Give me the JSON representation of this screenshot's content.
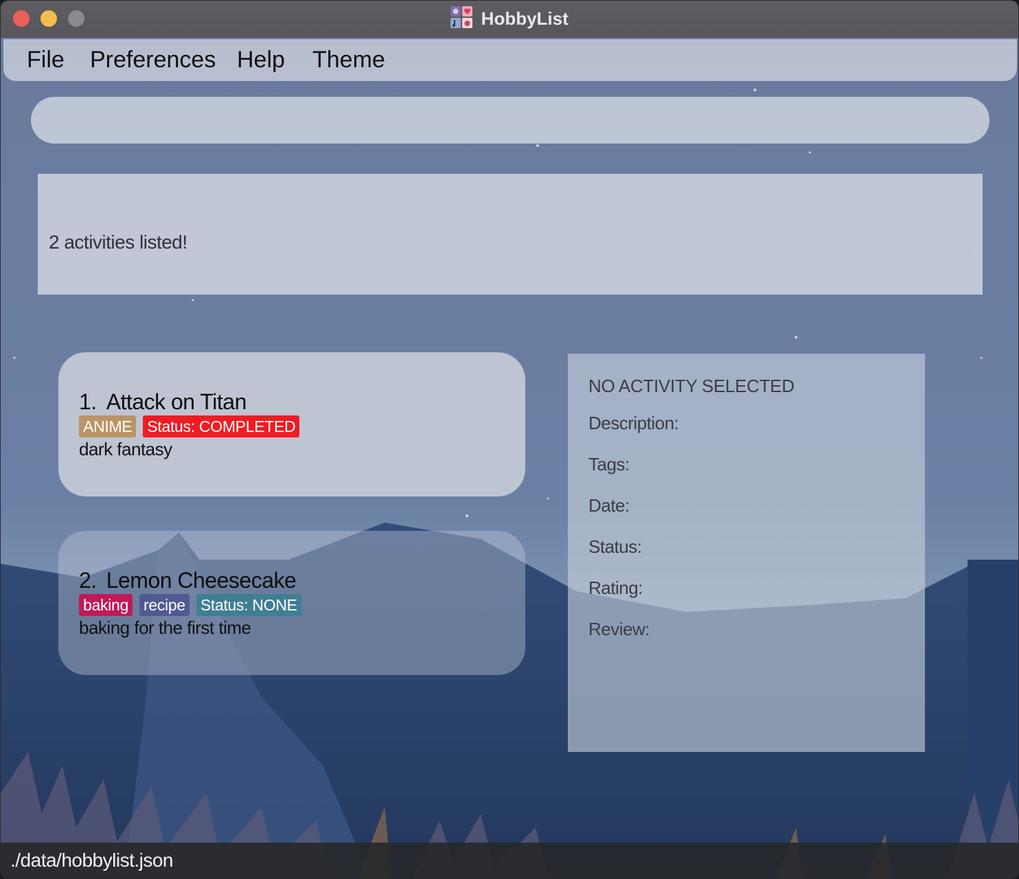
{
  "window": {
    "title": "HobbyList"
  },
  "menu": {
    "items": [
      "File",
      "Preferences",
      "Help",
      "Theme"
    ]
  },
  "command_box": {
    "value": "",
    "placeholder": ""
  },
  "result_display": {
    "text": "2 activities listed!"
  },
  "activities": [
    {
      "index": "1.",
      "name": "Attack on Titan",
      "tags": [
        {
          "label": "ANIME",
          "color": "#bb9467"
        },
        {
          "label": "Status: COMPLETED",
          "color": "#ee1c23"
        }
      ],
      "description": "dark fantasy"
    },
    {
      "index": "2.",
      "name": "Lemon Cheesecake",
      "tags": [
        {
          "label": "baking",
          "color": "#c01a58"
        },
        {
          "label": "recipe",
          "color": "#4f5a92"
        },
        {
          "label": "Status: NONE",
          "color": "#3f7f93"
        }
      ],
      "description": "baking for the first time"
    }
  ],
  "details": {
    "header": "NO ACTIVITY SELECTED",
    "labels": [
      "Description:",
      "Tags:",
      "Date:",
      "Status:",
      "Rating:",
      "Review:"
    ]
  },
  "status_bar": {
    "path": "./data/hobbylist.json"
  },
  "colors": {
    "close": "#ec5f57",
    "minimize": "#f4bd4f",
    "maximize_disabled": "#8a898d"
  }
}
